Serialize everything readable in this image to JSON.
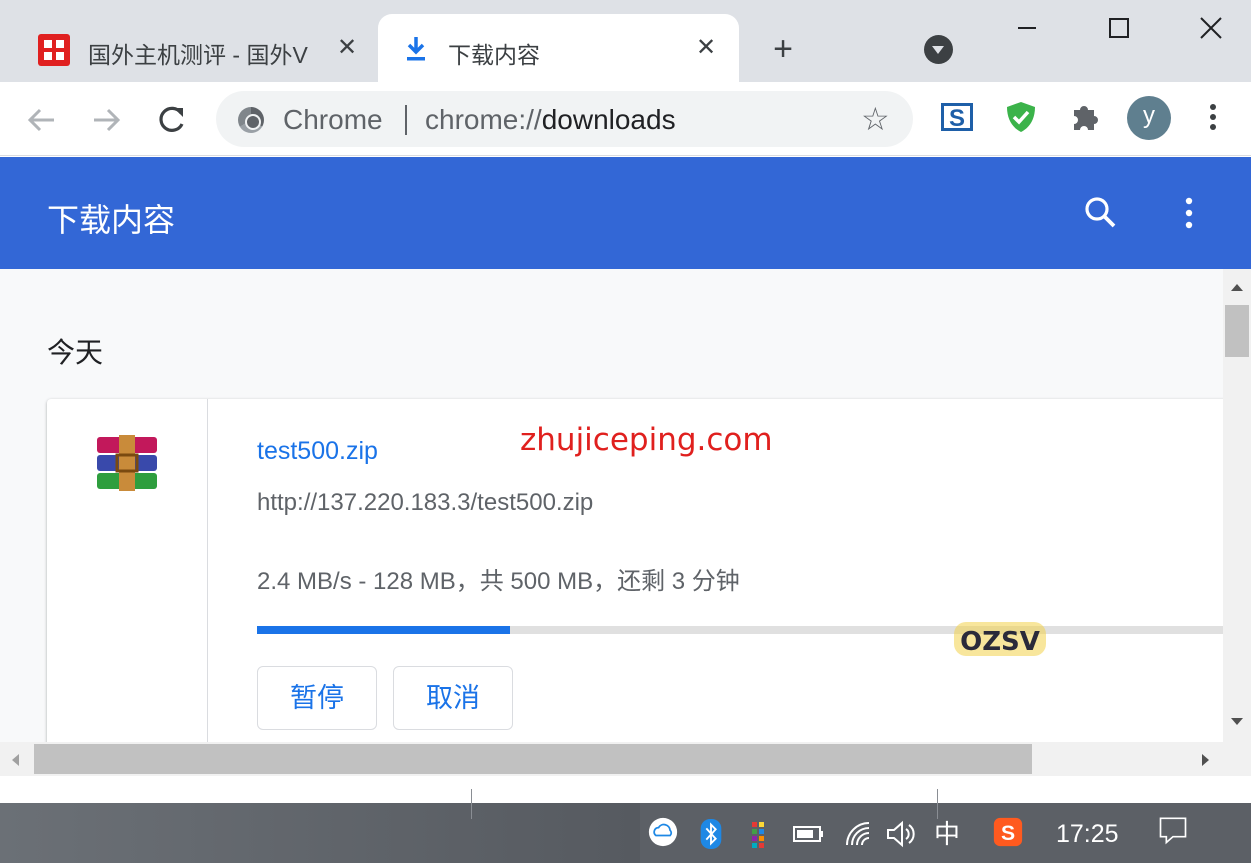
{
  "tabs": [
    {
      "title": "国外主机测评 - 国外V",
      "close": "✕",
      "icon": "site-favicon"
    },
    {
      "title": "下载内容",
      "close": "✕",
      "icon": "download-icon"
    }
  ],
  "window_controls": {
    "minimize": "—",
    "maximize": "☐",
    "close": "✕"
  },
  "omnibox": {
    "scheme_label": "Chrome",
    "url_prefix": "chrome://",
    "url_path": "downloads"
  },
  "extensions": {
    "avatar_letter": "y"
  },
  "header": {
    "title": "下载内容"
  },
  "section": {
    "date_label": "今天"
  },
  "download": {
    "file_name": "test500.zip",
    "url": "http://137.220.183.3/test500.zip",
    "status": "2.4 MB/s - 128 MB，共 500 MB，还剩 3 分钟",
    "progress_fraction": 0.256,
    "pause_label": "暂停",
    "cancel_label": "取消"
  },
  "watermark": {
    "text": "zhujiceping.com",
    "logo_text": "OZSV"
  },
  "taskbar": {
    "ime_label": "中",
    "clock": "17:25"
  },
  "colors": {
    "accent": "#3367d6",
    "link": "#1a73e8",
    "watermark": "#e0201e"
  }
}
